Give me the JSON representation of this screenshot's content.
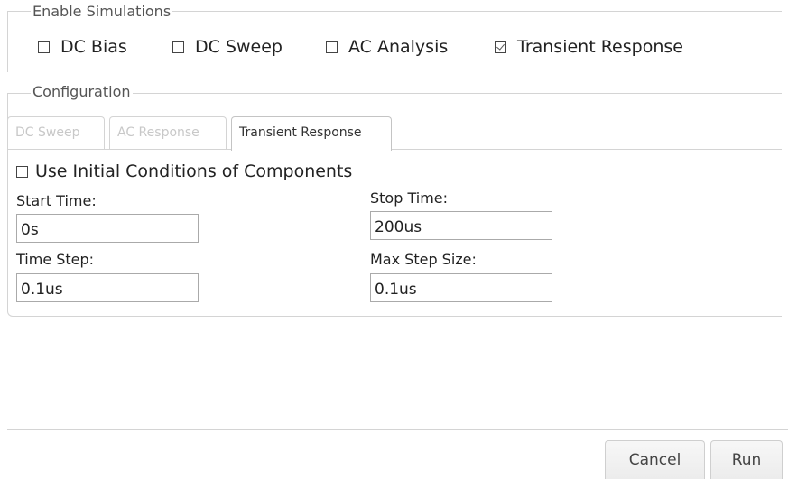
{
  "enable_simulations": {
    "legend": "Enable Simulations",
    "options": [
      {
        "label": "DC Bias",
        "checked": false
      },
      {
        "label": "DC Sweep",
        "checked": false
      },
      {
        "label": "AC Analysis",
        "checked": false
      },
      {
        "label": "Transient Response",
        "checked": true
      }
    ]
  },
  "configuration": {
    "legend": "Configuration",
    "tabs": [
      {
        "label": "DC Sweep",
        "state": "disabled"
      },
      {
        "label": "AC Response",
        "state": "disabled"
      },
      {
        "label": "Transient Response",
        "state": "active"
      }
    ],
    "transient": {
      "use_initial_conditions": {
        "label": "Use Initial Conditions of Components",
        "checked": false
      },
      "start_time": {
        "label": "Start Time:",
        "value": "0s"
      },
      "stop_time": {
        "label": "Stop Time:",
        "value": "200us"
      },
      "time_step": {
        "label": "Time Step:",
        "value": "0.1us"
      },
      "max_step_size": {
        "label": "Max Step Size:",
        "value": "0.1us"
      }
    }
  },
  "buttons": {
    "cancel": "Cancel",
    "run": "Run"
  }
}
